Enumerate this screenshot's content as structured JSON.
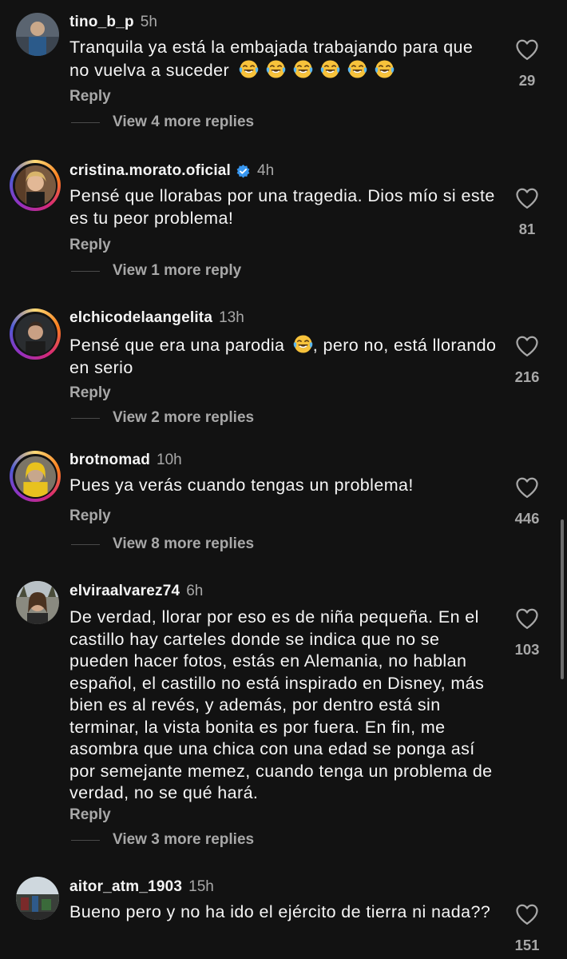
{
  "comments": [
    {
      "username": "tino_b_p",
      "time": "5h",
      "text": "Tranquila ya está la embajada trabajando para que no vuelva a suceder",
      "emojis": [
        "laughing-crying-emoji",
        "laughing-crying-emoji",
        "laughing-crying-emoji",
        "laughing-crying-emoji",
        "laughing-crying-emoji",
        "laughing-crying-emoji"
      ],
      "reply_label": "Reply",
      "more_replies": "View 4 more replies",
      "likes": "29"
    },
    {
      "username": "cristina.morato.oficial",
      "verified": true,
      "time": "4h",
      "text": "Pensé que llorabas por una tragedia. Dios mío si este es tu peor problema!",
      "reply_label": "Reply",
      "more_replies": "View 1 more reply",
      "likes": "81"
    },
    {
      "username": "elchicodelaangelita",
      "time": "13h",
      "text_before": "Pensé que era una parodia",
      "emoji": "laughing-crying-emoji",
      "text_after": ", pero no, está llorando en serio",
      "reply_label": "Reply",
      "more_replies": "View 2 more replies",
      "likes": "216"
    },
    {
      "username": "brotnomad",
      "time": "10h",
      "text": "Pues ya verás cuando tengas un problema!",
      "reply_label": "Reply",
      "more_replies": "View 8 more replies",
      "likes": "446"
    },
    {
      "username": "elviraalvarez74",
      "time": "6h",
      "text": "De verdad, llorar por eso es de niña pequeña. En el castillo hay carteles donde se indica que no se pueden hacer fotos, estás en Alemania, no hablan español, el castillo no está inspirado en Disney, más bien es al revés, y además, por dentro está sin terminar, la vista bonita es por fuera.  En fin, me asombra que una chica con una edad se ponga así por semejante memez, cuando tenga un problema de verdad, no se qué hará.",
      "reply_label": "Reply",
      "more_replies": "View 3 more replies",
      "likes": "103"
    },
    {
      "username": "aitor_atm_1903",
      "time": "15h",
      "text": "Bueno pero y no ha ido el ejército de tierra ni nada??",
      "likes": "151"
    }
  ],
  "colors": {
    "background": "#121212",
    "primary_text": "#f5f5f5",
    "secondary_text": "#a8a8a8",
    "verified_badge": "#3897f0",
    "story_ring": [
      "#feda75",
      "#fa7e1e",
      "#d62976",
      "#962fbf",
      "#4f5bd5"
    ]
  }
}
